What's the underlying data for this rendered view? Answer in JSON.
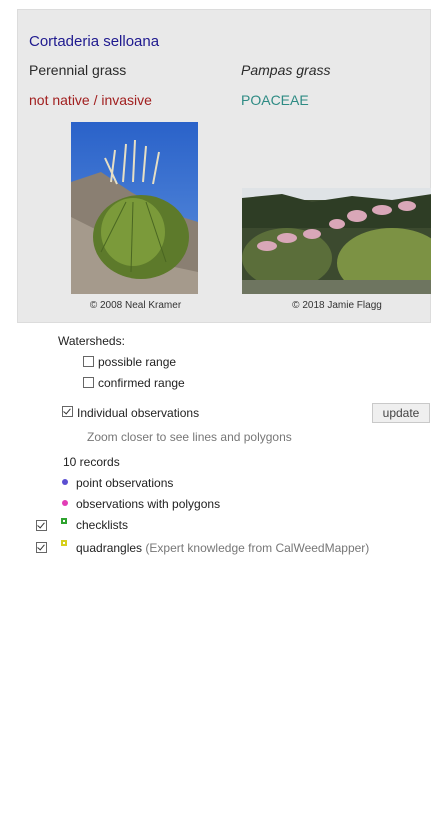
{
  "species": {
    "scientific_name": "Cortaderia selloana",
    "common_name": "Perennial grass",
    "alt_name": "Pampas grass",
    "status": "not native / invasive",
    "family": "POACEAE",
    "photos": [
      {
        "credit": "© 2008 Neal Kramer",
        "icon": "grass-photo"
      },
      {
        "credit": "© 2018 Jamie Flagg",
        "icon": "pampas-photo"
      }
    ]
  },
  "watersheds": {
    "heading": "Watersheds:",
    "possible_label": "possible range",
    "possible_checked": false,
    "confirmed_label": "confirmed range",
    "confirmed_checked": false
  },
  "observations": {
    "label": "Individual observations",
    "checked": true,
    "update_button": "update",
    "zoom_hint": "Zoom closer to see lines and polygons",
    "records": "10 records",
    "point_label": "point observations",
    "polygon_label": "observations with polygons"
  },
  "layers": {
    "checklists_label": "checklists",
    "checklists_checked": true,
    "quadrangles_label": "quadrangles",
    "quadrangles_note": "(Expert knowledge from CalWeedMapper)",
    "quadrangles_checked": true
  },
  "colors": {
    "point": "#5b4fd1",
    "polygon": "#e23db5",
    "checklists": "#2fa32f",
    "quadrangles": "#d6cf1e"
  }
}
